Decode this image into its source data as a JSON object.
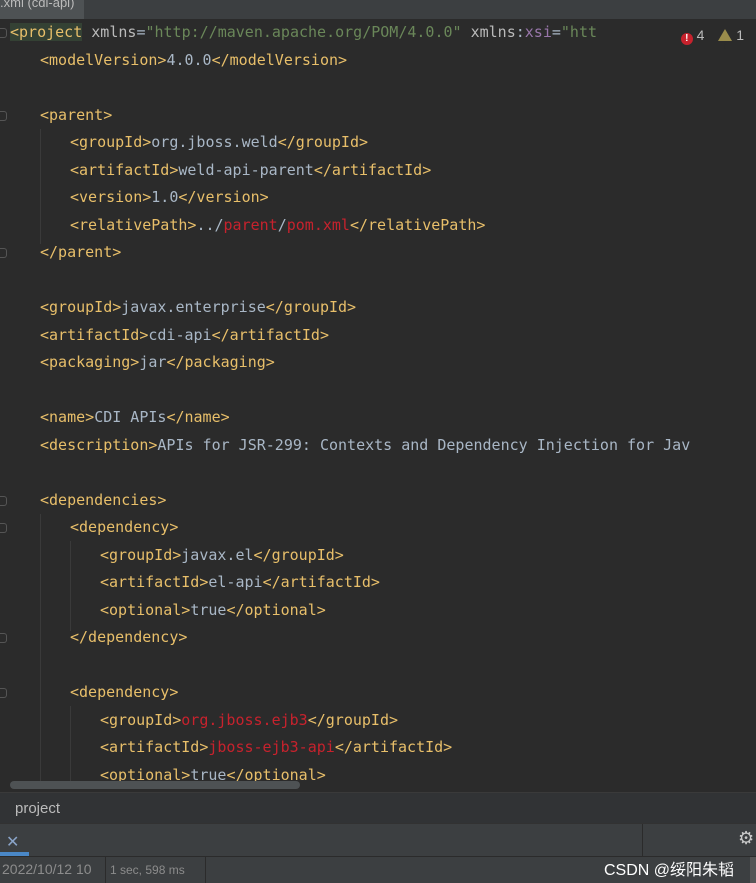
{
  "tab": {
    "title": ".xml (cdi-api)"
  },
  "inspections": {
    "errors": "4",
    "warnings": "1"
  },
  "code": {
    "l1": {
      "open": "<project",
      "a1": " xmlns",
      "eq1": "=",
      "v1": "\"http://maven.apache.org/POM/4.0.0\"",
      "a2": " xmlns",
      "colon": ":",
      "ns": "xsi",
      "eq2": "=",
      "v2": "\"htt"
    },
    "l2": {
      "o": "<modelVersion>",
      "t": "4.0.0",
      "c": "</modelVersion>"
    },
    "l4": {
      "o": "<parent>"
    },
    "l5": {
      "o": "<groupId>",
      "t": "org.jboss.weld",
      "c": "</groupId>"
    },
    "l6": {
      "o": "<artifactId>",
      "t": "weld-api-parent",
      "c": "</artifactId>"
    },
    "l7": {
      "o": "<version>",
      "t": "1.0",
      "c": "</version>"
    },
    "l8": {
      "o": "<relativePath>",
      "t1": "../",
      "e1": "parent",
      "t2": "/",
      "e2": "pom.xml",
      "c": "</relativePath>"
    },
    "l9": {
      "c": "</parent>"
    },
    "l11": {
      "o": "<groupId>",
      "t": "javax.enterprise",
      "c": "</groupId>"
    },
    "l12": {
      "o": "<artifactId>",
      "t": "cdi-api",
      "c": "</artifactId>"
    },
    "l13": {
      "o": "<packaging>",
      "t": "jar",
      "c": "</packaging>"
    },
    "l15": {
      "o": "<name>",
      "t": "CDI APIs",
      "c": "</name>"
    },
    "l16": {
      "o": "<description>",
      "t": "APIs for JSR-299: Contexts and Dependency Injection for Jav"
    },
    "l18": {
      "o": "<dependencies>"
    },
    "l19": {
      "o": "<dependency>"
    },
    "l20": {
      "o": "<groupId>",
      "t": "javax.el",
      "c": "</groupId>"
    },
    "l21": {
      "o": "<artifactId>",
      "t": "el-api",
      "c": "</artifactId>"
    },
    "l22": {
      "o": "<optional>",
      "t": "true",
      "c": "</optional>"
    },
    "l23": {
      "c": "</dependency>"
    },
    "l25": {
      "o": "<dependency>"
    },
    "l26": {
      "o": "<groupId>",
      "e": "org.jboss.ejb3",
      "c": "</groupId>"
    },
    "l27": {
      "o": "<artifactId>",
      "e": "jboss-ejb3-api",
      "c": "</artifactId>"
    },
    "l28": {
      "o": "<optional>",
      "t": "true",
      "c": "</optional>"
    }
  },
  "breadcrumb": {
    "item": "project"
  },
  "toolwindow": {
    "close_icon": "close-icon",
    "settings_icon": "gear-icon"
  },
  "status": {
    "timestamp": "2022/10/12 10",
    "duration": "1 sec, 598 ms",
    "watermark": "CSDN @绥阳朱韬"
  },
  "colors": {
    "background": "#2b2b2b",
    "tag": "#e8bf6a",
    "string": "#6a8759",
    "error": "#c7222d",
    "namespace": "#9876aa",
    "text": "#a9b7c6"
  }
}
